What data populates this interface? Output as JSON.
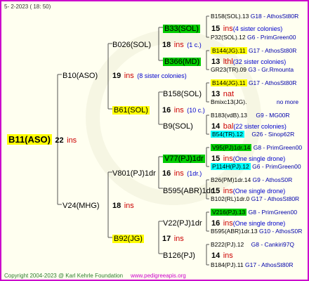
{
  "header": {
    "date": "5-  2-2023  ( 18:  50)"
  },
  "footer": {
    "copyright": "Copyright 2004-2023 @ Karl Kehrle Foundation",
    "url": "www.pedigreeapis.org"
  },
  "colors": {
    "border": "#cc00cc",
    "highlight_yellow": "#ffff00",
    "highlight_green": "#00cc00",
    "highlight_cyan": "#00ffff",
    "ins_red": "#cc0000",
    "info_blue": "#0000cc"
  },
  "root": {
    "name": "B11(ASO)",
    "num": "22",
    "ins": "ins"
  },
  "gen1": [
    {
      "name": "B10(ASO)",
      "num": "19",
      "ins": "ins",
      "note": "(8 sister colonies)"
    },
    {
      "name": "V24(MHG)",
      "num": "18",
      "ins": "ins"
    }
  ],
  "gen2": [
    {
      "name": "B026(SOL)",
      "num": "18",
      "ins": "ins",
      "note": "(1 c.)"
    },
    {
      "name": "B61(SOL)",
      "num": "16",
      "ins": "ins",
      "note": "(10 c.)"
    },
    {
      "name": "V801(PJ)1dr",
      "num": "16",
      "ins": "ins",
      "note": "(1dr.)"
    },
    {
      "name": "B92(JG)",
      "num": "17",
      "ins": "ins"
    }
  ],
  "gen3": [
    {
      "name": "B33(SOL)",
      "num": "15",
      "ins": "ins",
      "note": "(4 sister colonies)"
    },
    {
      "name": "B366(MD)",
      "num": "13",
      "ins": "lthl",
      "note": "(32 sister colonies)"
    },
    {
      "name": "B158(SOL)",
      "num": "13",
      "ins": "nat"
    },
    {
      "name": "B9(SOL)",
      "num": "14",
      "ins": "bal",
      "note": "(22 sister colonies)"
    },
    {
      "name": "V77(PJ)1dr",
      "num": "15",
      "ins": "ins",
      "note": "(One single drone)"
    },
    {
      "name": "B595(ABR)1dr",
      "num": "15",
      "ins": "ins",
      "note": "(One single drone)"
    },
    {
      "name": "V22(PJ)1dr",
      "num": "16",
      "ins": "ins",
      "note": "(One single drone)"
    },
    {
      "name": "B126(PJ)",
      "num": "14",
      "ins": "ins"
    }
  ],
  "gen4": [
    {
      "name": "B158(SOL).13",
      "info": "G18 - AthosSt80R"
    },
    {
      "name": "P32(SOL).12",
      "info": "G6 - PrimGreen00"
    },
    {
      "name": "B144(JG).11",
      "info": "G17 - AthosSt80R"
    },
    {
      "name": "GR23(TR).09",
      "info": "G3 - Gr.Rmounta"
    },
    {
      "name": "B144(JG).11",
      "info": "G17 - AthosSt80R"
    },
    {
      "name": "Bmixc13(JG).",
      "info": "no more"
    },
    {
      "name": "B183(vdB).13",
      "info": "G9 - MG00R"
    },
    {
      "name": "B54(TR).12",
      "info": "G26 - Sinop62R"
    },
    {
      "name": "V95(PJ)1dr.14",
      "info": "G8 - PrimGreen00"
    },
    {
      "name": "P114H(PJ).12",
      "info": "G6 - PrimGreen00"
    },
    {
      "name": "B26(PM)1dr.14",
      "info": "G9 - AthosS0R"
    },
    {
      "name": "B102(RL)1dr.0",
      "info": "G17 - AthosSt80R"
    },
    {
      "name": "V216(PJ).13",
      "info": "G8 - PrimGreen00"
    },
    {
      "name": "B595(ABR)1dr.13",
      "info": "G10 - AthosS0R"
    },
    {
      "name": "B222(PJ).12",
      "info": "G8 - Cankiri97Q"
    },
    {
      "name": "B184(PJ).11",
      "info": "G17 - AthosSt80R"
    }
  ]
}
